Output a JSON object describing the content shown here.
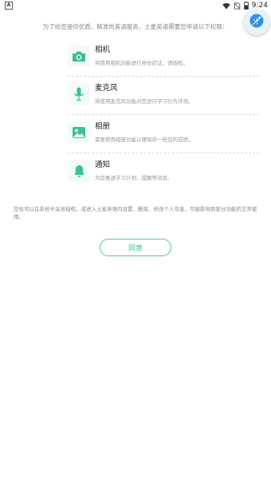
{
  "status_bar": {
    "app_letter": "A",
    "time": "9:24",
    "battery_level": 0.6
  },
  "floating_button": {
    "icon": "rocket-icon"
  },
  "intro": "为了给您提供优质、精准的英语服务，土星英语需要您申请以下权限：",
  "permissions": [
    {
      "title": "相机",
      "description": "将使用相机功能进行身份验证，请授权。",
      "icon": "camera-icon"
    },
    {
      "title": "麦克风",
      "description": "将使用麦克风功能对您进行学习行为评测。",
      "icon": "microphone-icon"
    },
    {
      "title": "相册",
      "description": "需要使用相册功能以便保存一些您的成绩。",
      "icon": "photo-icon"
    },
    {
      "title": "通知",
      "description": "为您推送学习计划、提醒等消息。",
      "icon": "bell-icon"
    }
  ],
  "footer_note": "您也可以在系统中关闭授权，或进入土星英语内设置、删除、修改个人信息，可能影响到部分功能的正常使用。",
  "agree_button": "同意",
  "colors": {
    "accent": "#3cbf9a",
    "accent_border": "#4ec7a6",
    "icon_bg": "#f2fbf8"
  }
}
